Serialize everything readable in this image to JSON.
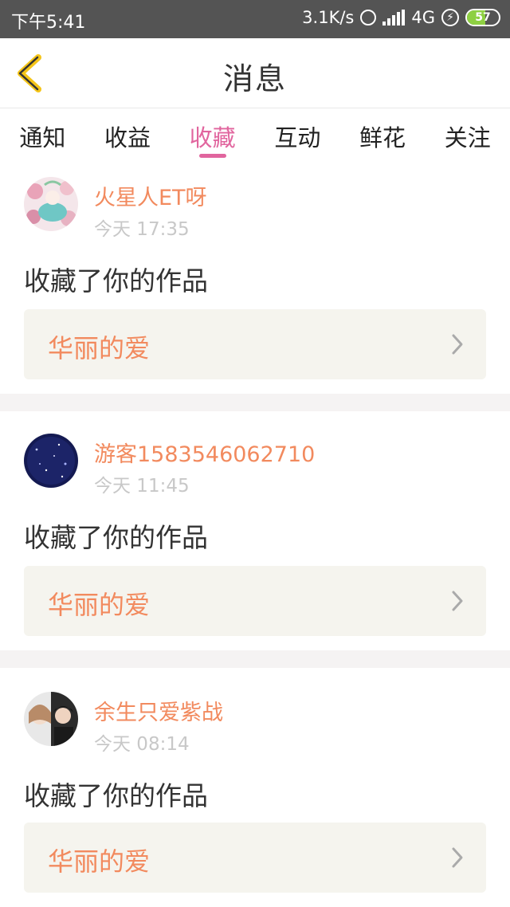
{
  "status_bar": {
    "time": "下午5:41",
    "speed": "3.1K/s",
    "network": "4G",
    "battery": "57",
    "battery_color": "#8ed042"
  },
  "header": {
    "title": "消息",
    "back_icon": "chevron-left-icon",
    "back_color": "#f5c518"
  },
  "tabs": [
    {
      "label": "通知",
      "active": false
    },
    {
      "label": "收益",
      "active": false
    },
    {
      "label": "收藏",
      "active": true
    },
    {
      "label": "互动",
      "active": false
    },
    {
      "label": "鲜花",
      "active": false
    },
    {
      "label": "关注",
      "active": false
    }
  ],
  "accent_color": "#e1659e",
  "messages": [
    {
      "username": "火星人ET呀",
      "time": "今天 17:35",
      "action": "收藏了你的作品",
      "work_title": "华丽的爱"
    },
    {
      "username": "游客1583546062710",
      "time": "今天 11:45",
      "action": "收藏了你的作品",
      "work_title": "华丽的爱"
    },
    {
      "username": "余生只爱紫战",
      "time": "今天 08:14",
      "action": "收藏了你的作品",
      "work_title": "华丽的爱"
    }
  ]
}
